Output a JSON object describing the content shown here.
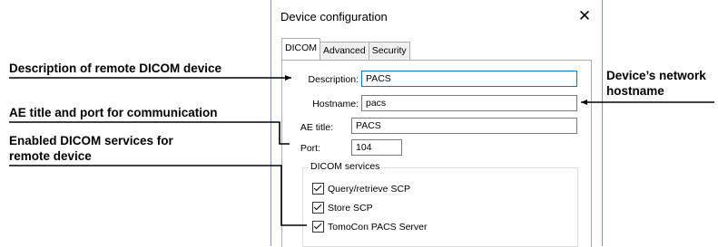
{
  "dialog": {
    "title": "Device configuration",
    "close_glyph": "✕",
    "tabs": [
      {
        "label": "DICOM",
        "active": true
      },
      {
        "label": "Advanced",
        "active": false
      },
      {
        "label": "Security",
        "active": false
      }
    ],
    "fields": {
      "description": {
        "label": "Description:",
        "value": "PACS"
      },
      "hostname": {
        "label": "Hostname:",
        "value": "pacs"
      },
      "ae_title": {
        "label": "AE title:",
        "value": "PACS"
      },
      "port": {
        "label": "Port:",
        "value": "104"
      }
    },
    "services_group": {
      "title": "DICOM services",
      "items": [
        {
          "label": "Query/retrieve SCP",
          "checked": true
        },
        {
          "label": "Store SCP",
          "checked": true
        },
        {
          "label": "TomoCon PACS Server",
          "checked": true
        }
      ]
    }
  },
  "annotations": {
    "description": "Description of remote DICOM device",
    "ae_title_port": "AE title and port for communication",
    "services_line1": "Enabled DICOM services for",
    "services_line2": "remote device",
    "hostname_line1": "Device’s network",
    "hostname_line2": "hostname"
  },
  "colors": {
    "focus_border": "#0078d7",
    "window_border": "#7a9cc8"
  }
}
